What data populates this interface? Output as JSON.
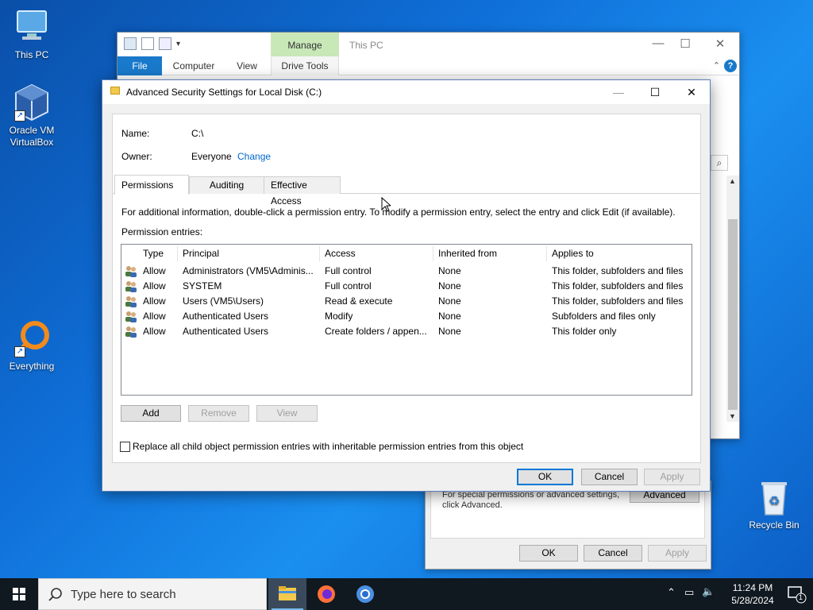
{
  "desktop": {
    "icons": [
      {
        "label": "This PC"
      },
      {
        "label": "Oracle VM VirtualBox"
      },
      {
        "label": "Everything"
      },
      {
        "label": "Recycle Bin"
      }
    ]
  },
  "explorer": {
    "manage_tab": "Manage",
    "title": "This PC",
    "tabs": [
      "File",
      "Computer",
      "View",
      "Drive Tools"
    ],
    "help": "?"
  },
  "properties": {
    "text_line1": "For special permissions or advanced settings,",
    "text_line2": "click Advanced.",
    "advanced_button": "Advanced",
    "ok": "OK",
    "cancel": "Cancel",
    "apply": "Apply"
  },
  "dialog": {
    "title": "Advanced Security Settings for Local Disk (C:)",
    "name_label": "Name:",
    "name_value": "C:\\",
    "owner_label": "Owner:",
    "owner_value": "Everyone",
    "change_link": "Change",
    "tabs": [
      "Permissions",
      "Auditing",
      "Effective Access"
    ],
    "info_text": "For additional information, double-click a permission entry. To modify a permission entry, select the entry and click Edit (if available).",
    "entries_label": "Permission entries:",
    "columns": [
      "Type",
      "Principal",
      "Access",
      "Inherited from",
      "Applies to"
    ],
    "rows": [
      [
        "Allow",
        "Administrators (VM5\\Adminis...",
        "Full control",
        "None",
        "This folder, subfolders and files"
      ],
      [
        "Allow",
        "SYSTEM",
        "Full control",
        "None",
        "This folder, subfolders and files"
      ],
      [
        "Allow",
        "Users (VM5\\Users)",
        "Read & execute",
        "None",
        "This folder, subfolders and files"
      ],
      [
        "Allow",
        "Authenticated Users",
        "Modify",
        "None",
        "Subfolders and files only"
      ],
      [
        "Allow",
        "Authenticated Users",
        "Create folders / appen...",
        "None",
        "This folder only"
      ]
    ],
    "add": "Add",
    "remove": "Remove",
    "view": "View",
    "replace_checkbox": "Replace all child object permission entries with inheritable permission entries from this object",
    "ok": "OK",
    "cancel": "Cancel",
    "apply": "Apply"
  },
  "taskbar": {
    "search_placeholder": "Type here to search",
    "time": "11:24 PM",
    "date": "5/28/2024",
    "notification_count": "1"
  }
}
